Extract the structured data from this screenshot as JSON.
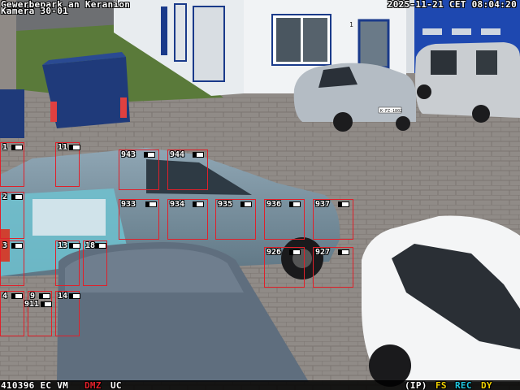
{
  "osd": {
    "location": "Gewerbepark an Keranion",
    "camera": "Kamera 30-01",
    "timestamp": "2025-11-21 CET 08:04:20"
  },
  "building": {
    "door_number": "1"
  },
  "vehicles": {
    "parked_suv_plate": "K-FZ-1802"
  },
  "detections": [
    {
      "id": "1"
    },
    {
      "id": "11"
    },
    {
      "id": "943"
    },
    {
      "id": "944"
    },
    {
      "id": "2"
    },
    {
      "id": "933"
    },
    {
      "id": "934"
    },
    {
      "id": "935"
    },
    {
      "id": "936"
    },
    {
      "id": "937"
    },
    {
      "id": "3"
    },
    {
      "id": "13"
    },
    {
      "id": "18"
    },
    {
      "id": "926"
    },
    {
      "id": "927"
    },
    {
      "id": "4"
    },
    {
      "id": "9"
    },
    {
      "id": "14"
    },
    {
      "id": "911"
    }
  ],
  "status": {
    "left": "410396 EC VM",
    "alert": "DMZ",
    "mode": "UC",
    "ip": "(IP)",
    "fs": "FS",
    "rec": "REC",
    "dy": "DY",
    "colors": {
      "alert": "#e0202a",
      "fs": "#f0d000",
      "rec": "#20c8e0",
      "dy": "#f0d000",
      "box": "#e0202a"
    }
  }
}
